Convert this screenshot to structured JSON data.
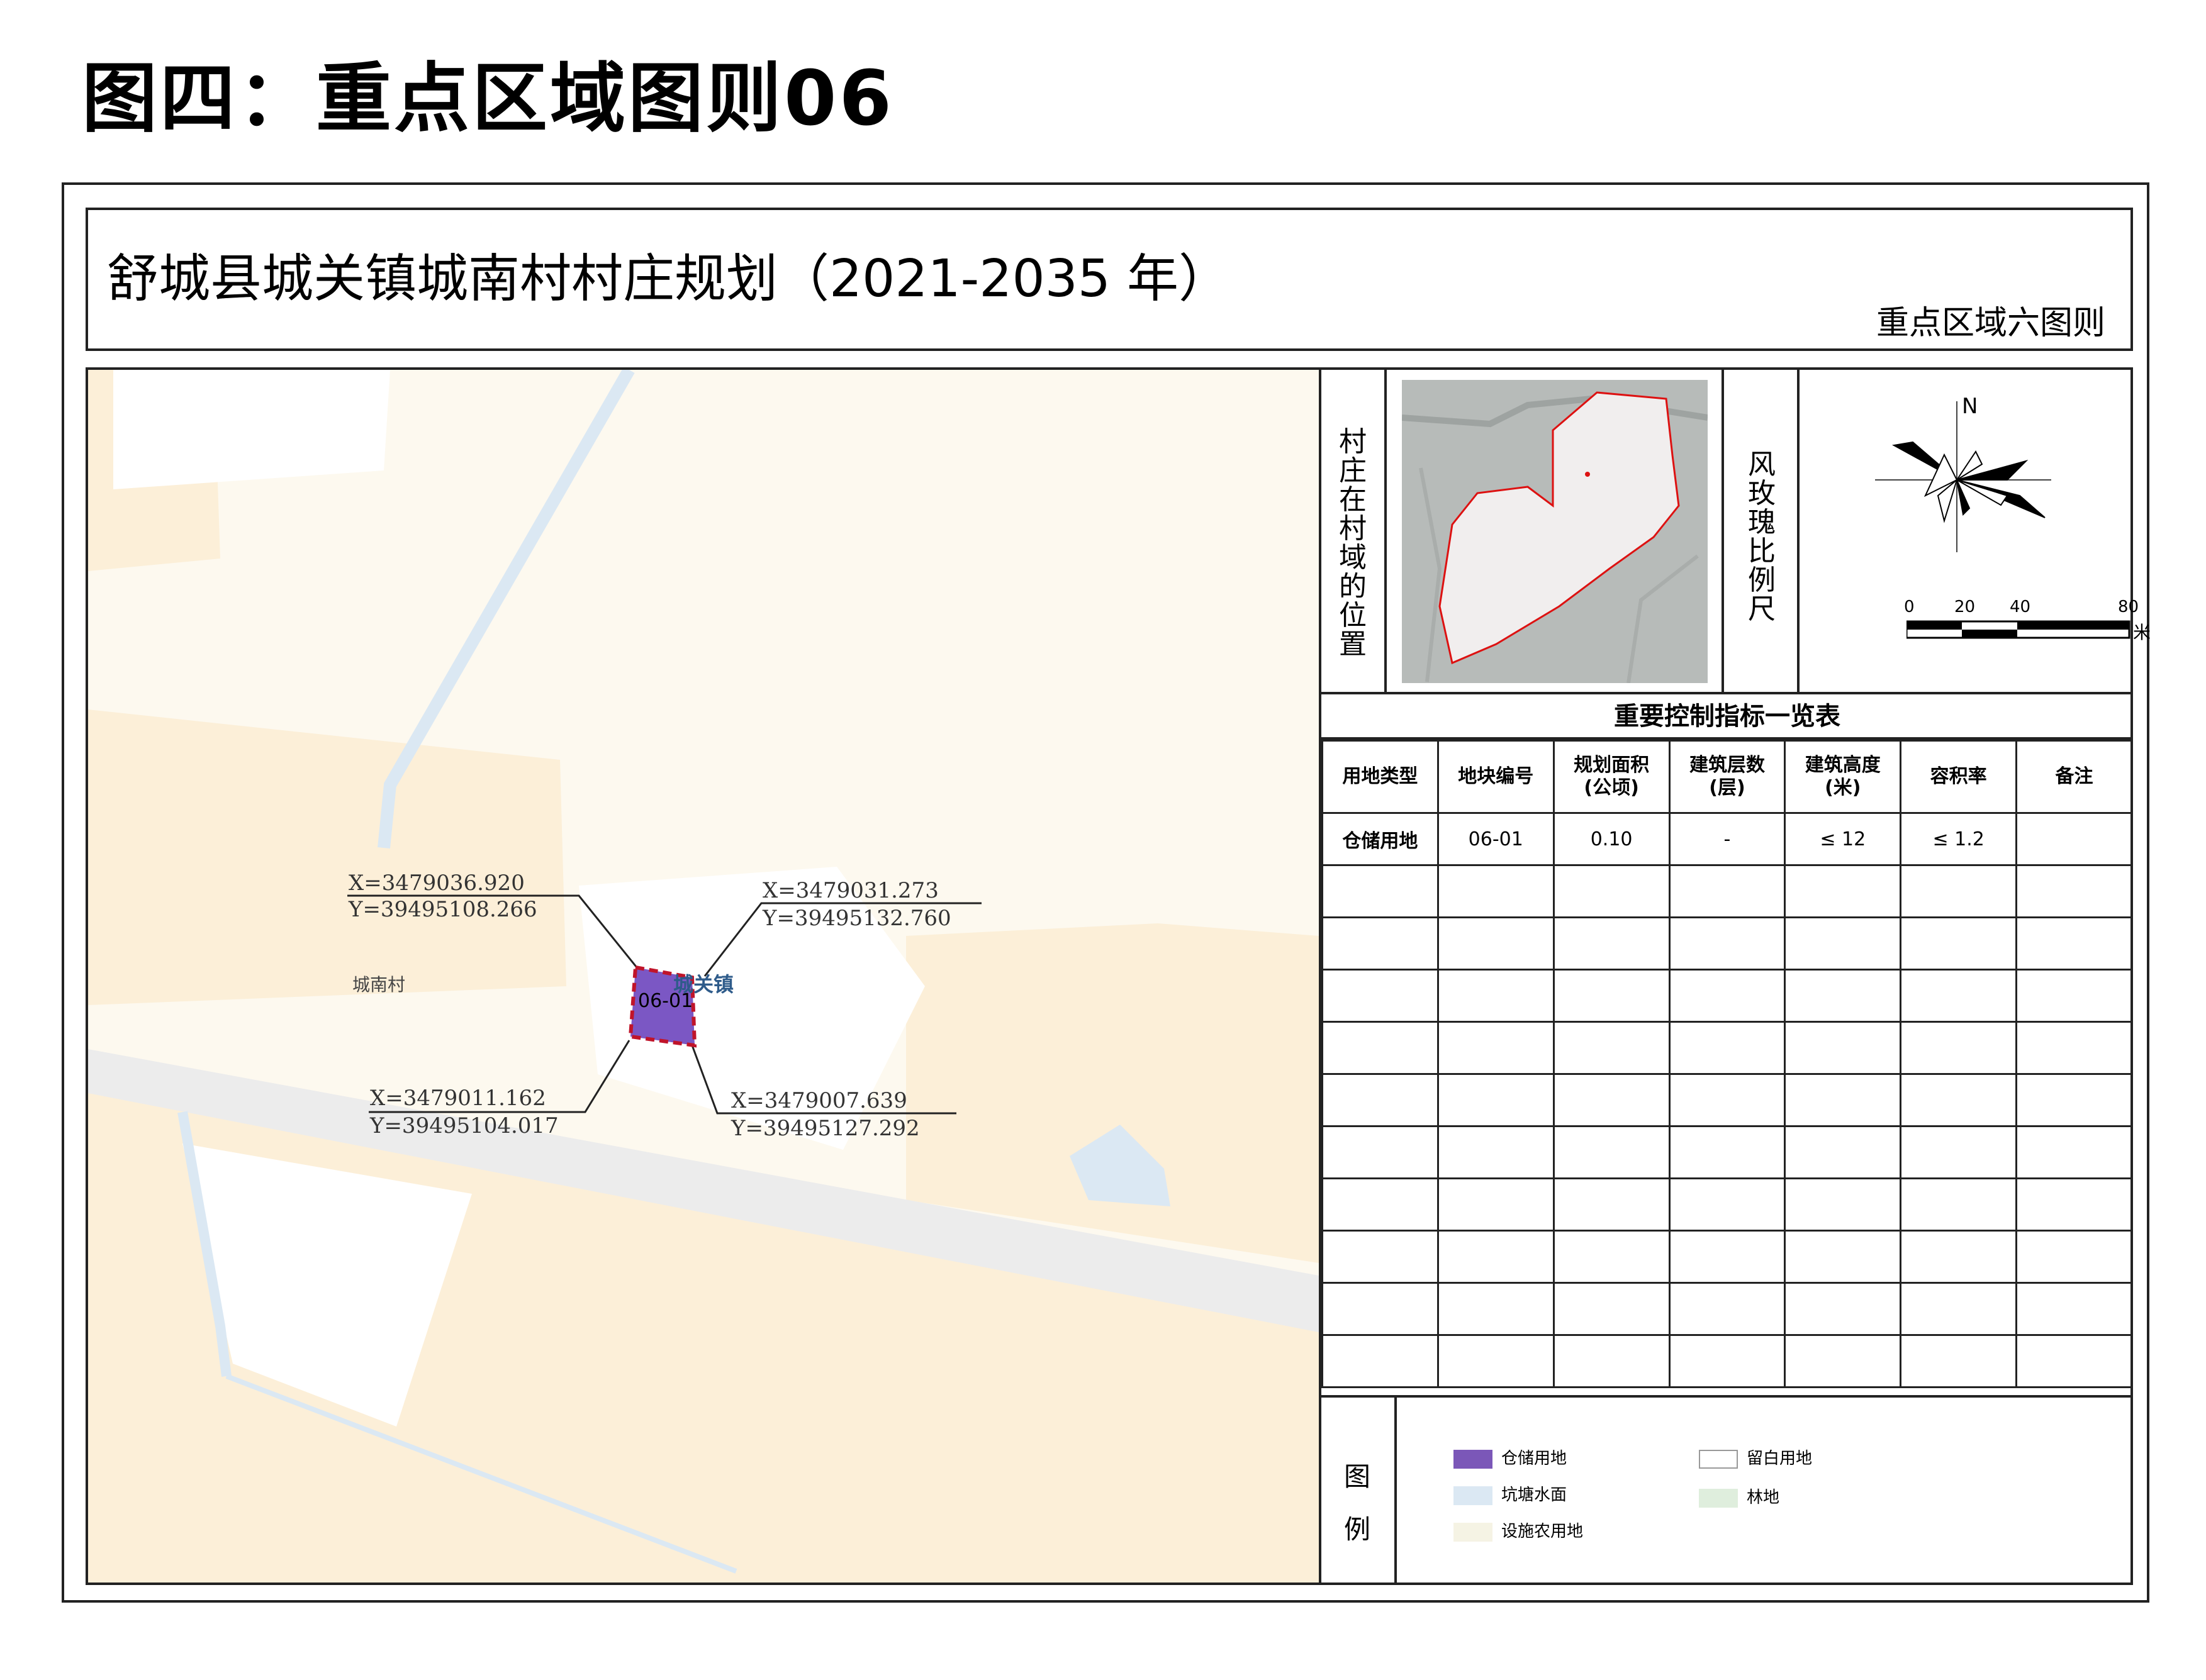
{
  "page_title": "图四：重点区域图则06",
  "plan_title": "舒城县城关镇城南村村庄规划（2021-2035 年）",
  "plan_subtitle": "重点区域六图则",
  "map": {
    "village_label": "城南村",
    "town_label": "城关镇",
    "parcel_label": "06-01",
    "coords": {
      "top_left": {
        "x": "X=3479036.920",
        "y": "Y=39495108.266"
      },
      "top_right": {
        "x": "X=3479031.273",
        "y": "Y=39495132.760"
      },
      "bottom_left": {
        "x": "X=3479011.162",
        "y": "Y=39495104.017"
      },
      "bottom_right": {
        "x": "X=3479007.639",
        "y": "Y=39495127.292"
      }
    },
    "colors": {
      "parcel_fill": "#7b57c4",
      "parcel_border": "#c0142a",
      "water": "#dbe8f3",
      "farmland": "#fcefd9",
      "road": "#ececec"
    }
  },
  "sidebar": {
    "location_label": "村庄在村域的位置",
    "windrose_label": "风玫瑰比例尺",
    "north_label": "N",
    "scale": {
      "ticks": [
        "0",
        "20",
        "40",
        "80"
      ],
      "unit": "米"
    }
  },
  "table": {
    "title": "重要控制指标一览表",
    "headers": [
      {
        "line1": "用地类型",
        "line2": ""
      },
      {
        "line1": "地块编号",
        "line2": ""
      },
      {
        "line1": "规划面积",
        "line2": "(公顷)"
      },
      {
        "line1": "建筑层数",
        "line2": "(层)"
      },
      {
        "line1": "建筑高度",
        "line2": "(米)"
      },
      {
        "line1": "容积率",
        "line2": ""
      },
      {
        "line1": "备注",
        "line2": ""
      }
    ],
    "rows": [
      [
        "仓储用地",
        "06-01",
        "0.10",
        "-",
        "≤ 12",
        "≤ 1.2",
        ""
      ]
    ],
    "empty_rows": 10
  },
  "legend": {
    "label_top": "图",
    "label_bottom": "例",
    "items": [
      {
        "label": "仓储用地",
        "color": "#7b57b8"
      },
      {
        "label": "留白用地",
        "color": "#ffffff"
      },
      {
        "label": "坑塘水面",
        "color": "#dbe8f3"
      },
      {
        "label": "林地",
        "color": "#dfeedd"
      },
      {
        "label": "设施农用地",
        "color": "#f5f3e4"
      }
    ]
  }
}
